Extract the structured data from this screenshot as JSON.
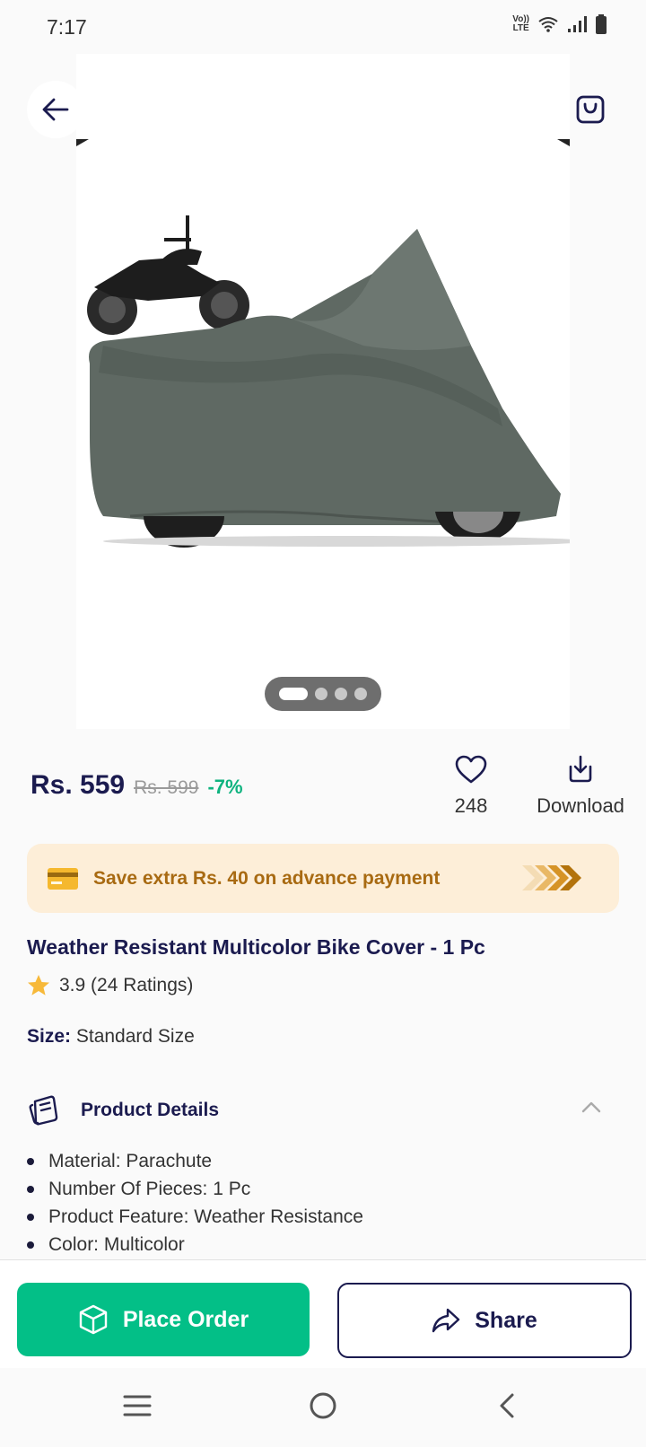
{
  "status_bar": {
    "time": "7:17",
    "volte": "Vo)) LTE",
    "icons": [
      "volte-icon",
      "wifi-icon",
      "signal-icon",
      "battery-icon"
    ]
  },
  "header": {
    "icons": [
      "back-arrow-icon",
      "shopping-bag-icon"
    ]
  },
  "gallery": {
    "image_count": 4,
    "active_index": 0
  },
  "price": {
    "current": "Rs. 559",
    "original": "Rs. 599",
    "discount": "-7%"
  },
  "actions": {
    "wishlist_count": "248",
    "download_label": "Download"
  },
  "offer": {
    "text": "Save extra Rs. 40 on advance payment",
    "icon": "credit-card-icon"
  },
  "product": {
    "title": "Weather Resistant Multicolor Bike Cover - 1 Pc",
    "rating": "3.9 (24 Ratings)",
    "size_label": "Size:",
    "size_value": "Standard Size"
  },
  "details": {
    "title": "Product Details",
    "items": [
      "Material: Parachute",
      "Number Of Pieces: 1 Pc",
      "Product Feature: Weather Resistance",
      "Color: Multicolor"
    ]
  },
  "bottom_actions": {
    "order_label": "Place Order",
    "share_label": "Share"
  },
  "colors": {
    "primary": "#03bf87",
    "navy": "#1b1b4f",
    "offer_bg": "#fdeed8",
    "offer_text": "#a86a12"
  }
}
